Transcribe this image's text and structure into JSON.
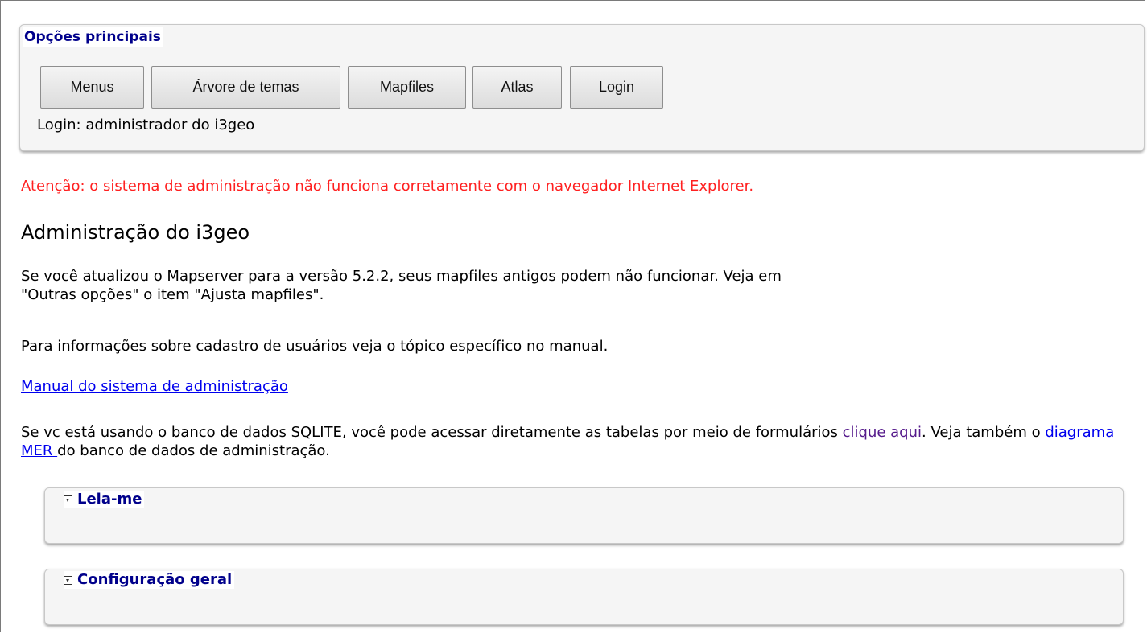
{
  "main_options": {
    "title": "Opções principais",
    "buttons": [
      {
        "label": "Menus"
      },
      {
        "label": "Árvore de temas"
      },
      {
        "label": "Mapfiles"
      },
      {
        "label": "Atlas"
      },
      {
        "label": "Login"
      }
    ],
    "login_status": "Login: administrador do i3geo"
  },
  "warning": "Atenção: o sistema de administração não funciona corretamente com o navegador Internet Explorer.",
  "page_title": "Administração do i3geo",
  "paragraphs": {
    "mapserver_notice_line1": "Se você atualizou o Mapserver para a versão 5.2.2, seus mapfiles antigos podem não funcionar. Veja em",
    "mapserver_notice_line2": "\"Outras opções\" o item \"Ajusta mapfiles\".",
    "users_info": "Para informações sobre cadastro de usuários veja o tópico específico no manual.",
    "manual_link": "Manual do sistema de administração",
    "sqlite_part1": "Se vc está usando o banco de dados SQLITE, você pode acessar diretamente as tabelas por meio de formulários ",
    "sqlite_link": "clique aqui",
    "sqlite_part2": ". Veja também o ",
    "mer_link": "diagrama MER ",
    "sqlite_part3": "do banco de dados de administração."
  },
  "panels": [
    {
      "title": "Leia-me",
      "icon": "collapse-icon"
    },
    {
      "title": "Configuração geral",
      "icon": "collapse-icon"
    }
  ],
  "colors": {
    "warning": "#ff2020",
    "heading_blue": "#00008b",
    "link": "#0000ee",
    "visited_link": "#551a8b"
  }
}
